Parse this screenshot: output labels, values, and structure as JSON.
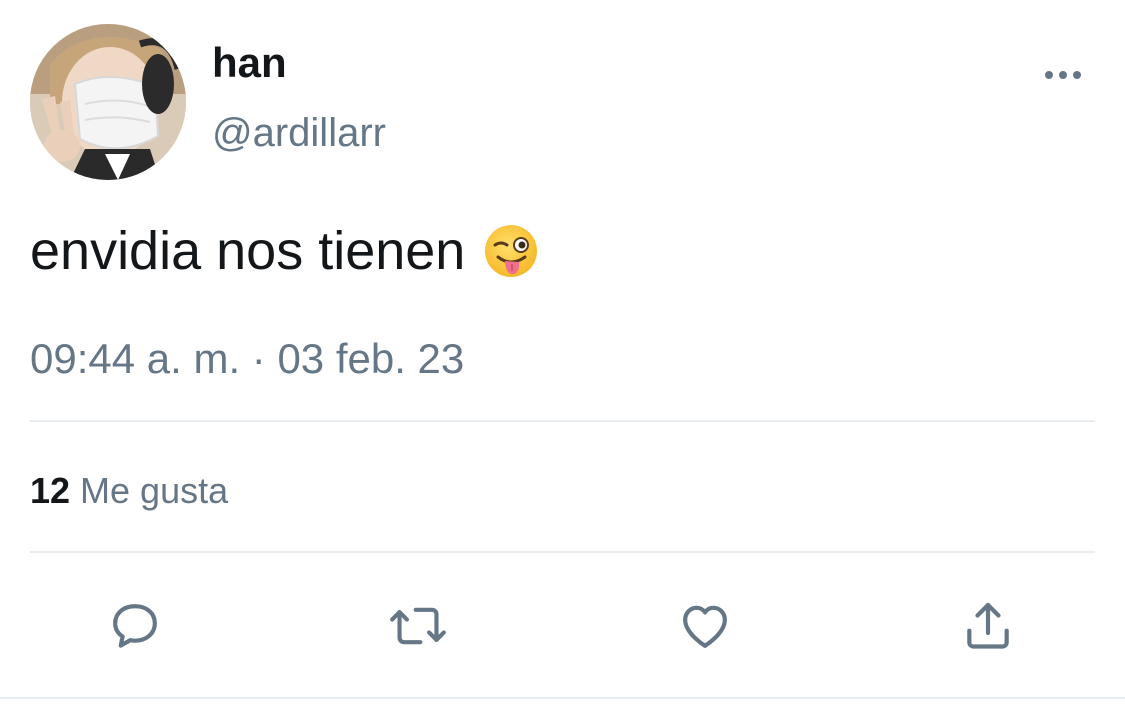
{
  "tweet": {
    "author": {
      "display_name": "han",
      "handle": "@ardillarr",
      "avatar_icon": "profile-photo"
    },
    "text": "envidia nos tienen",
    "emoji": "winking-face-with-tongue",
    "timestamp": "09:44 a. m. · 03 feb. 23",
    "stats": {
      "likes_count": "12",
      "likes_label": "Me gusta"
    },
    "actions": [
      "reply-icon",
      "retweet-icon",
      "like-icon",
      "share-icon"
    ],
    "menu_icon": "more-options-icon"
  },
  "colors": {
    "text_primary": "#14171a",
    "text_secondary": "#657786",
    "divider": "#e6ecf0",
    "background": "#ffffff"
  }
}
